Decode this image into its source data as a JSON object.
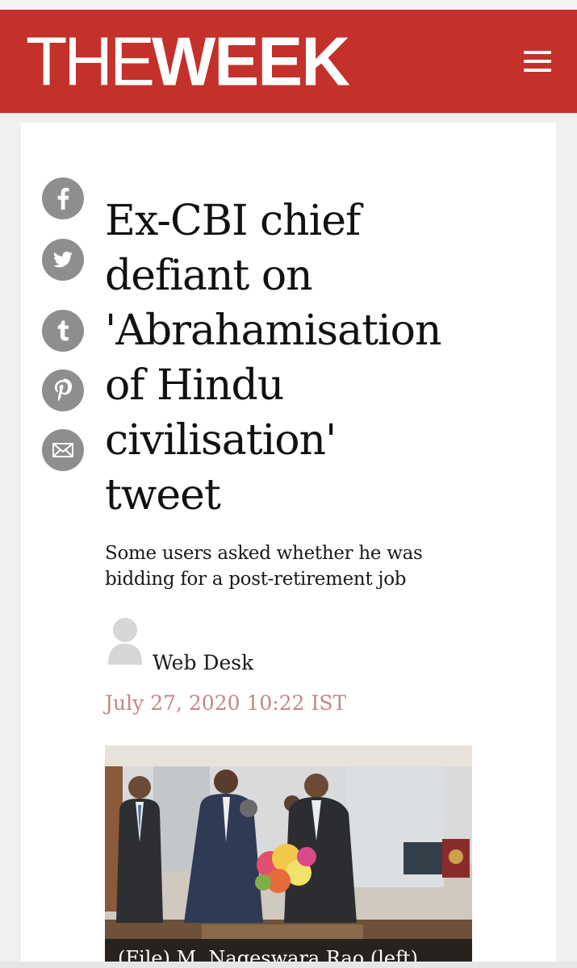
{
  "header": {
    "logo_the": "THE",
    "logo_week": "WEEK",
    "menu_icon": "hamburger-menu-icon",
    "brand_color": "#c4302a"
  },
  "share": [
    {
      "icon": "facebook-icon"
    },
    {
      "icon": "twitter-icon"
    },
    {
      "icon": "tumblr-icon"
    },
    {
      "icon": "pinterest-icon"
    },
    {
      "icon": "email-icon"
    }
  ],
  "article": {
    "title_lines": [
      "Ex-CBI chief",
      "defiant on",
      "'Abrahamisation",
      "of Hindu",
      "civilisation'",
      "tweet"
    ],
    "subtitle_lines": [
      "Some users asked whether he was",
      "bidding for a post-retirement job"
    ],
    "author": "Web Desk",
    "date": "July 27, 2020 10:22 IST",
    "date_color": "#c1878a",
    "image_caption": "(File) M. Nageswara Rao (left)"
  }
}
